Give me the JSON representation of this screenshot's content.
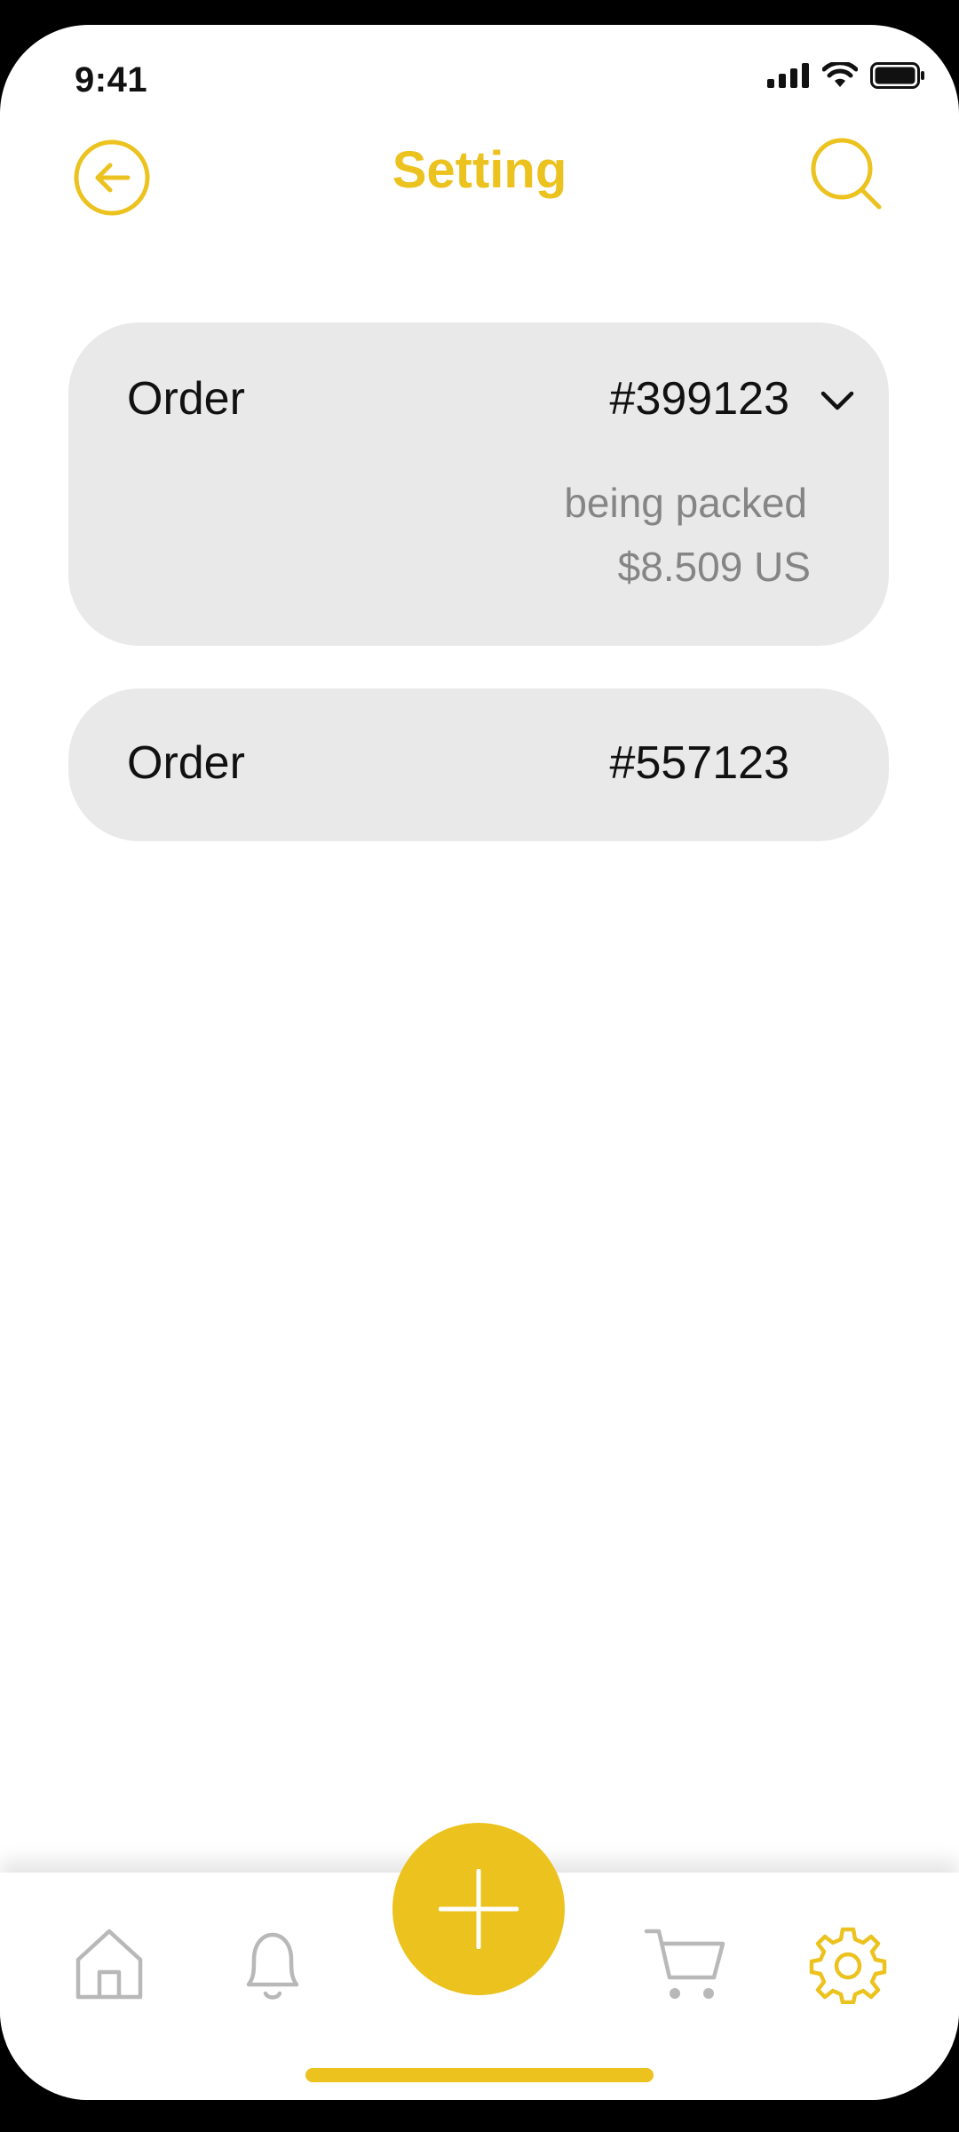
{
  "status_bar": {
    "time": "9:41",
    "icons": [
      "signal-icon",
      "wifi-icon",
      "battery-icon"
    ]
  },
  "header": {
    "title": "Setting",
    "back_icon": "arrow-left-circle-icon",
    "search_icon": "search-icon"
  },
  "orders": [
    {
      "label": "Order",
      "number": "#399123",
      "status": "being packed",
      "price": "$8.509 US",
      "expanded": true
    },
    {
      "label": "Order",
      "number": "#557123",
      "expanded": false
    }
  ],
  "bottom_nav": {
    "items": [
      {
        "icon": "home-icon",
        "active": false
      },
      {
        "icon": "bell-icon",
        "active": false
      },
      {
        "icon": "plus-icon",
        "active": false
      },
      {
        "icon": "cart-icon",
        "active": false
      },
      {
        "icon": "gear-icon",
        "active": true
      }
    ]
  },
  "colors": {
    "accent": "#ecc21f",
    "card_bg": "#e9e9e9",
    "text": "#111111",
    "muted": "#858585",
    "nav_inactive": "#b8b8b8"
  }
}
